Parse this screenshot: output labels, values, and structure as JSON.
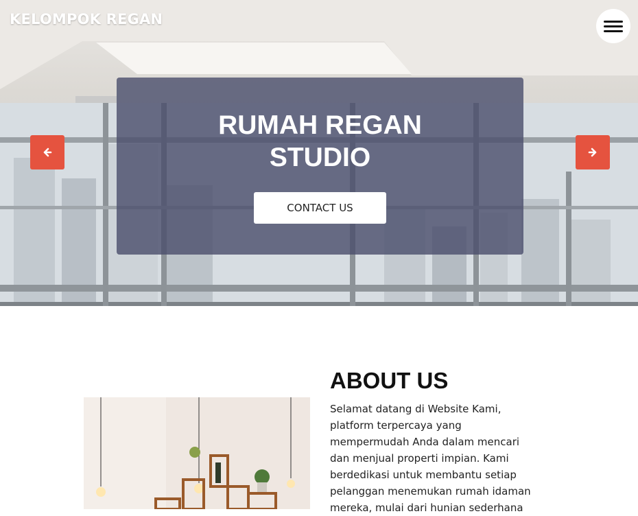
{
  "header": {
    "brand": "KELOMPOK REGAN",
    "menu_icon": "hamburger-icon"
  },
  "hero": {
    "title_line1": "RUMAH REGAN",
    "title_line2": "STUDIO",
    "cta_label": "CONTACT US",
    "prev_icon": "arrow-left-icon",
    "next_icon": "arrow-right-icon",
    "accent_color": "#e5533f",
    "overlay_color": "#4a4e6c"
  },
  "about": {
    "title": "ABOUT US",
    "lines": [
      "Selamat datang di Website Kami,",
      "platform terpercaya yang",
      "mempermudah Anda dalam mencari",
      "dan menjual properti impian. Kami",
      "berdedikasi untuk membantu setiap",
      "pelanggan menemukan rumah idaman",
      "mereka, mulai dari hunian sederhana"
    ]
  }
}
